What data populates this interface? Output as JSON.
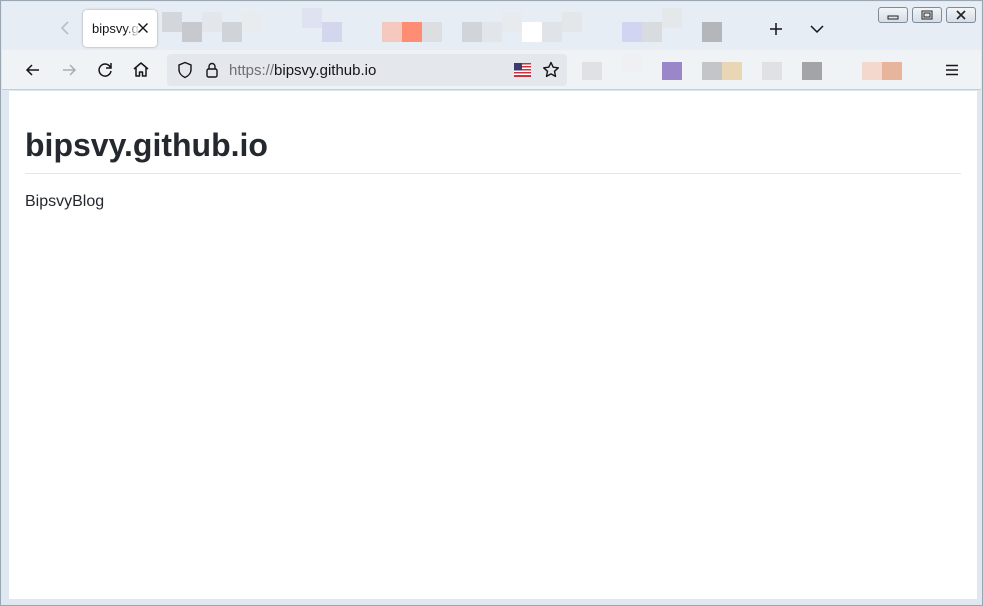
{
  "browser": {
    "tab": {
      "title": "bipsvy.github.io"
    },
    "urlbar": {
      "scheme": "https://",
      "host": "bipsvy.github.io"
    },
    "icons": {
      "back": "arrow-left-icon",
      "forward": "arrow-right-icon",
      "reload": "reload-icon",
      "home": "home-icon",
      "tracking": "shield-icon",
      "lock": "lock-icon",
      "flag": "us-flag-icon",
      "bookmark": "star-icon",
      "menu": "hamburger-menu-icon",
      "new_tab": "plus-icon",
      "tab_list": "chevron-down-icon",
      "close_tab": "close-icon"
    }
  },
  "page": {
    "title": "bipsvy.github.io",
    "body_text": "BipsvyBlog"
  },
  "colors": {
    "heading": "#24292f",
    "tab_strip": "#e6edf4",
    "nav_bar": "#f0f3f6"
  }
}
